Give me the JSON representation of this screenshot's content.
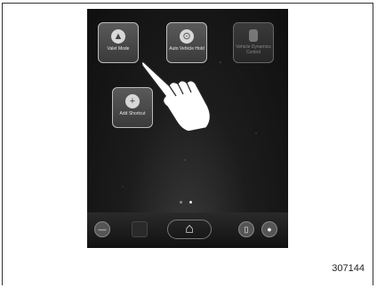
{
  "home_screen": {
    "tiles": [
      {
        "label": "Valet Mode",
        "icon": "car-person-icon",
        "active": true
      },
      {
        "label": "Auto Vehicle Hold",
        "icon": "vehicle-hold-icon",
        "active": true
      },
      {
        "label": "Vehicle Dynamics Control",
        "icon": "vdc-icon",
        "active": false
      },
      {
        "label": "Add Shortcut",
        "icon": "plus-icon",
        "active": true
      }
    ],
    "page_indicator": {
      "current": 2,
      "total": 2
    }
  },
  "bottom_bar": {
    "buttons": [
      "back-icon",
      "blank-key",
      "home-icon",
      "phone-icon",
      "profile-icon"
    ]
  },
  "figure_number": "307144"
}
